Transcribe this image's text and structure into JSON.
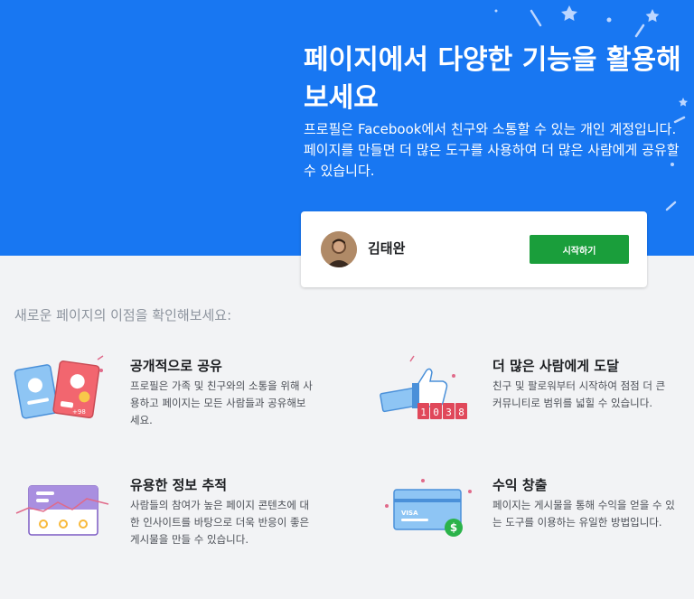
{
  "hero": {
    "title": "페이지에서 다양한 기능을 활용해보세요",
    "description": "프로필은 Facebook에서 친구와 소통할 수 있는 개인 계정입니다. 페이지를 만들면 더 많은 도구를 사용하여 더 많은 사람에게 공유할 수 있습니다."
  },
  "card": {
    "user_name": "김태완",
    "start_button": "시작하기"
  },
  "benefits_title": "새로운 페이지의 이점을 확인해보세요:",
  "benefits": [
    {
      "title": "공개적으로 공유",
      "description": "프로필은 가족 및 친구와의 소통을 위해 사용하고 페이지는 모든 사람들과 공유해보세요.",
      "badge": "+98"
    },
    {
      "title": "더 많은 사람에게 도달",
      "description": "친구 및 팔로워부터 시작하여 점점 더 큰 커뮤니티로 범위를 넓힐 수 있습니다.",
      "counter": [
        "1",
        "0",
        "3",
        "8"
      ]
    },
    {
      "title": "유용한 정보 추적",
      "description": "사람들의 참여가 높은 페이지 콘텐츠에 대한 인사이트를 바탕으로 더욱 반응이 좋은 게시물을 만들 수 있습니다."
    },
    {
      "title": "수익 창출",
      "description": "페이지는 게시물을 통해 수익을 얻을 수 있는 도구를 이용하는 유일한 방법입니다.",
      "card_label": "VISA"
    }
  ],
  "colors": {
    "hero_bg": "#1877f2",
    "button_green": "#1a9e3b",
    "page_bg": "#f2f3f5"
  }
}
